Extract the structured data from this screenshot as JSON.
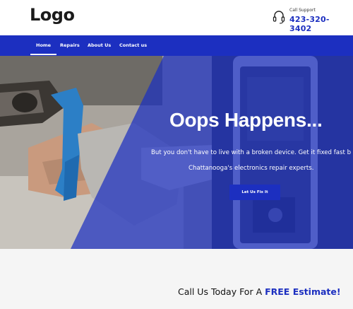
{
  "header": {
    "logo": "Logo",
    "support_label": "Call Support",
    "support_phone": "423-320-3402"
  },
  "nav": {
    "items": [
      "Home",
      "Repairs",
      "About Us",
      "Contact us"
    ],
    "active": "Home"
  },
  "hero": {
    "title": "Oops Happens...",
    "subtitle_line1": "But you don't have to live with a broken device. Get it fixed fast b",
    "subtitle_line2": "Chattanooga's electronics repair experts.",
    "button_label": "Let Us Fix It"
  },
  "cta": {
    "text": "Call Us Today For A ",
    "highlight": "FREE Estimate!"
  },
  "colors": {
    "brand_blue": "#1c2fc0",
    "white": "#ffffff",
    "light_gray": "#f5f5f5"
  },
  "icons": {
    "support": "headset-icon"
  }
}
